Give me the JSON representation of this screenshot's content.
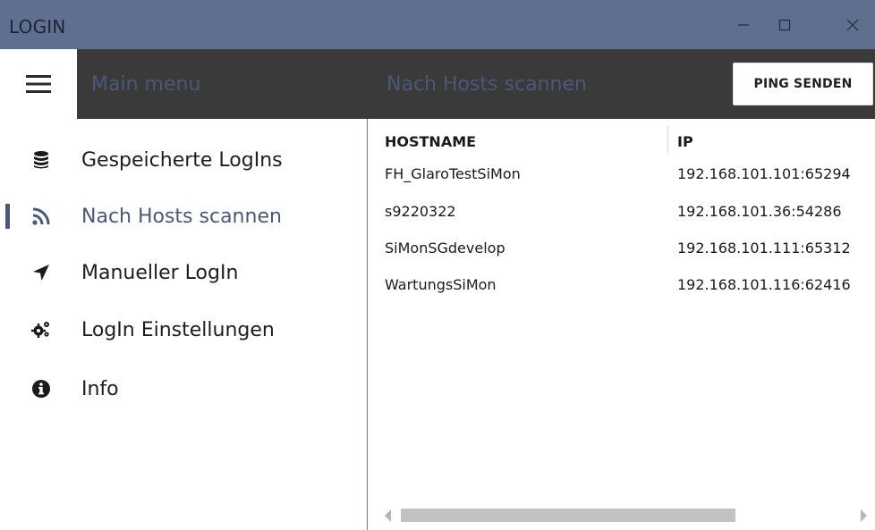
{
  "window": {
    "title": "LOGIN",
    "controls": [
      "minimize-icon",
      "maximize-icon",
      "close-icon"
    ]
  },
  "header": {
    "main_menu_label": "Main menu",
    "page_title": "Nach Hosts scannen",
    "ping_button_label": "PING SENDEN",
    "background": "#3a3a3a",
    "muted_text_color": "#4a587a"
  },
  "sidebar": {
    "items": [
      {
        "label": "Gespeicherte LogIns",
        "icon": "database-icon",
        "active": false
      },
      {
        "label": "Nach Hosts scannen",
        "icon": "rss-feed-icon",
        "active": true
      },
      {
        "label": "Manueller LogIn",
        "icon": "location-arrow-icon",
        "active": false
      },
      {
        "label": "LogIn Einstellungen",
        "icon": "gears-icon",
        "active": false
      },
      {
        "label": "Info",
        "icon": "info-circle-icon",
        "active": false
      }
    ]
  },
  "table": {
    "columns": [
      "HOSTNAME",
      "IP"
    ],
    "rows": [
      {
        "hostname": "FH_GlaroTestSiMon",
        "ip": "192.168.101.101:65294"
      },
      {
        "hostname": "s9220322",
        "ip": "192.168.101.36:54286"
      },
      {
        "hostname": "SiMonSGdevelop",
        "ip": "192.168.101.111:65312"
      },
      {
        "hostname": "WartungsSiMon",
        "ip": "192.168.101.116:62416"
      }
    ]
  },
  "colors": {
    "titlebar": "#5f6f8f",
    "accent": "#4a587a"
  }
}
